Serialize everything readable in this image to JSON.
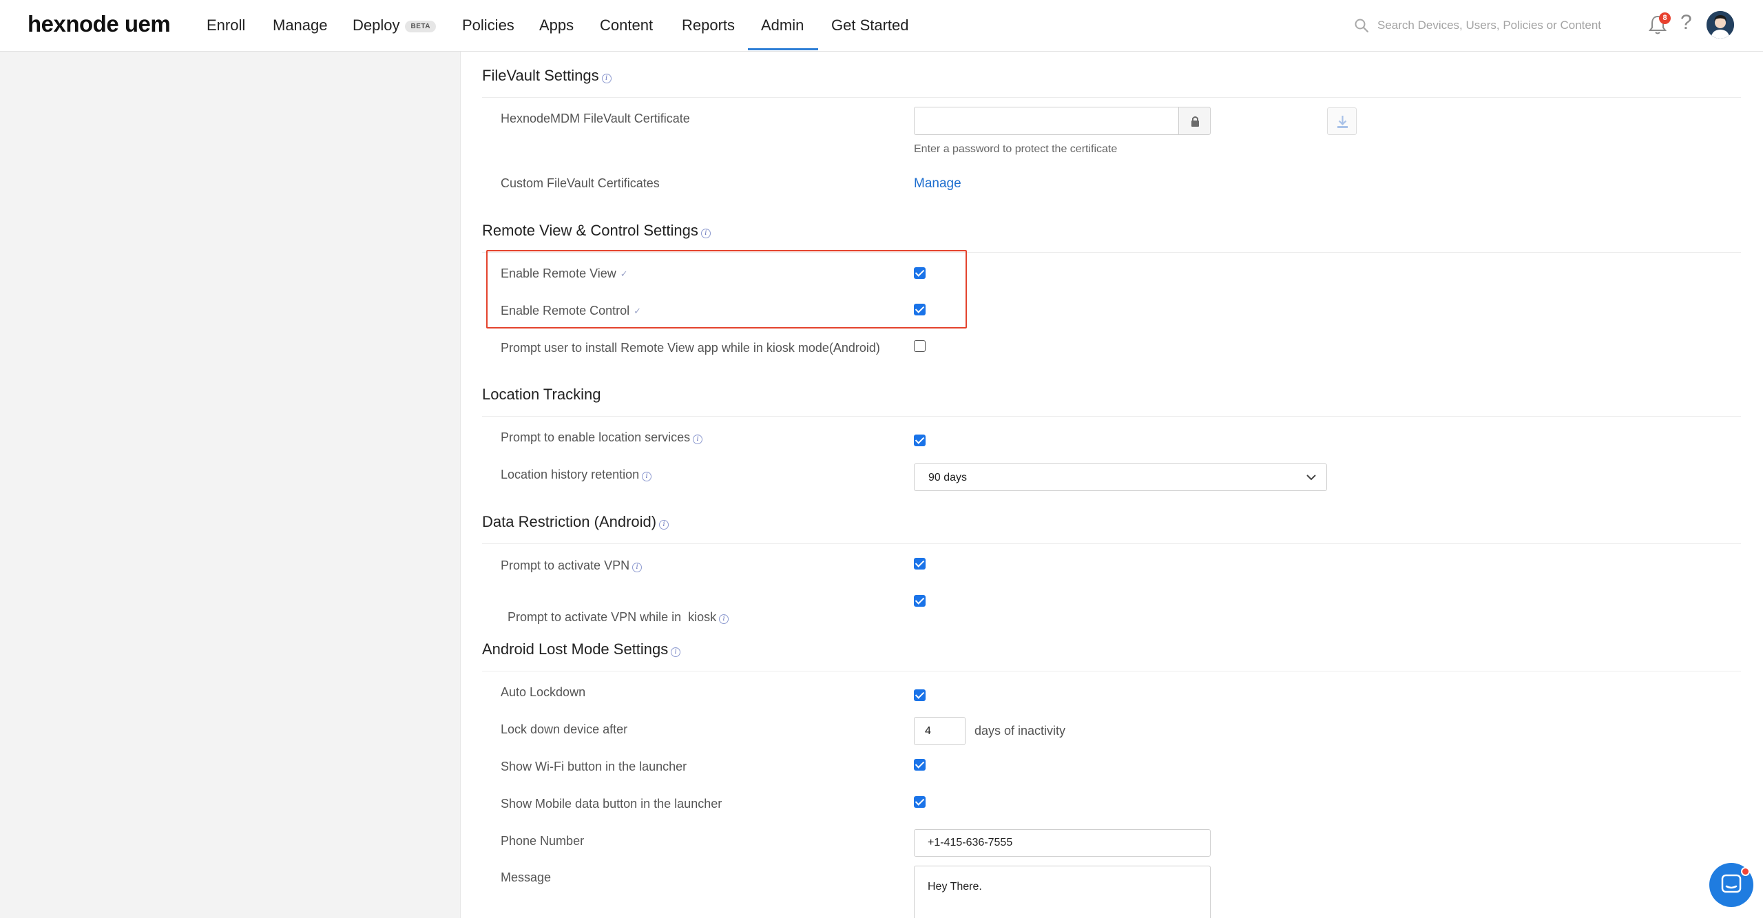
{
  "app": {
    "logo": "hexnode uem"
  },
  "nav": {
    "items": [
      "Enroll",
      "Manage",
      "Deploy",
      "Policies",
      "Apps",
      "Content",
      "Reports",
      "Admin",
      "Get Started"
    ],
    "beta_badge": "BETA",
    "active": "Admin"
  },
  "search": {
    "placeholder": "Search Devices, Users, Policies or Content"
  },
  "notifications": {
    "count": "8"
  },
  "filevault": {
    "title": "FileVault Settings",
    "cert_label": "HexnodeMDM FileVault Certificate",
    "password_value": "",
    "password_hint": "Enter a password to protect the certificate",
    "custom_label": "Custom FileVault Certificates",
    "manage_link": "Manage"
  },
  "remote": {
    "title": "Remote View & Control Settings",
    "enable_view_label": "Enable Remote View",
    "enable_view": true,
    "enable_control_label": "Enable Remote Control",
    "enable_control": true,
    "prompt_kiosk_label": "Prompt user to install Remote View app while in kiosk mode(Android)",
    "prompt_kiosk": false
  },
  "location": {
    "title": "Location Tracking",
    "prompt_label": "Prompt to enable location services",
    "prompt": true,
    "retention_label": "Location history retention",
    "retention_value": "90 days"
  },
  "data_restriction": {
    "title": "Data Restriction (Android)",
    "vpn_label": "Prompt to activate VPN",
    "vpn": true,
    "vpn_kiosk_label": "Prompt to activate VPN while in  kiosk",
    "vpn_kiosk": true
  },
  "lost_mode": {
    "title": "Android Lost Mode Settings",
    "auto_lockdown_label": "Auto Lockdown",
    "auto_lockdown": true,
    "lockdown_after_label": "Lock down device after",
    "lockdown_after_value": "4",
    "lockdown_after_suffix": "days of inactivity",
    "wifi_label": "Show Wi-Fi button in the launcher",
    "wifi": true,
    "mobile_data_label": "Show Mobile data button in the launcher",
    "mobile_data": true,
    "phone_label": "Phone Number",
    "phone_value": "+1-415-636-7555",
    "message_label": "Message",
    "message_value": "Hey There."
  },
  "colors": {
    "accent": "#1a73e8",
    "highlight": "#e4432d",
    "link": "#1f6fcf"
  }
}
